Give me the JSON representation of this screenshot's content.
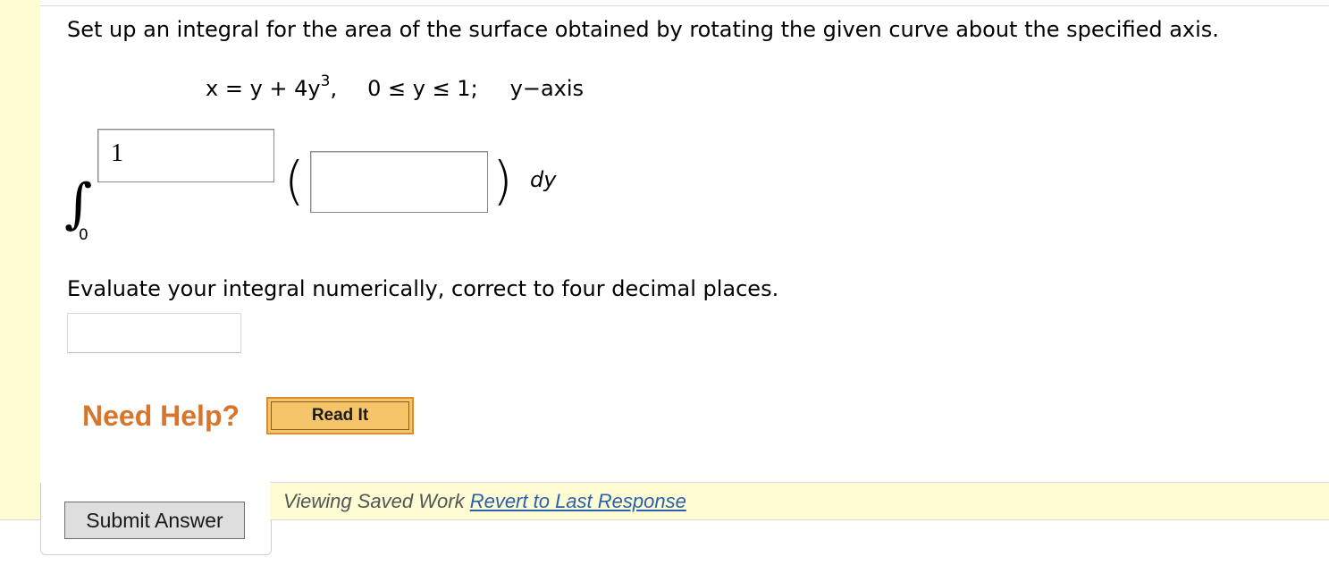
{
  "question": {
    "prompt": "Set up an integral for the area of the surface obtained by rotating the given curve about the specified axis.",
    "equation": {
      "lhs": "x = y + 4y",
      "exponent": "3",
      "after_exponent": ",",
      "range": "0 ≤ y ≤ 1;",
      "axis": "y−axis"
    }
  },
  "integral": {
    "lower_limit": "0",
    "upper_limit_value": "1",
    "integrand_value": "",
    "differential": "dy"
  },
  "evaluate": {
    "prompt": "Evaluate your integral numerically, correct to four decimal places.",
    "answer_value": ""
  },
  "help": {
    "label": "Need Help?",
    "read_it_label": "Read It"
  },
  "submit": {
    "label": "Submit Answer"
  },
  "saved_work": {
    "text": "Viewing Saved Work",
    "revert_label": "Revert to Last Response"
  },
  "colors": {
    "accent_yellow": "#fdfcd2",
    "help_orange": "#d9742b",
    "button_orange": "#f6c469",
    "link_blue": "#2a5fb0"
  }
}
